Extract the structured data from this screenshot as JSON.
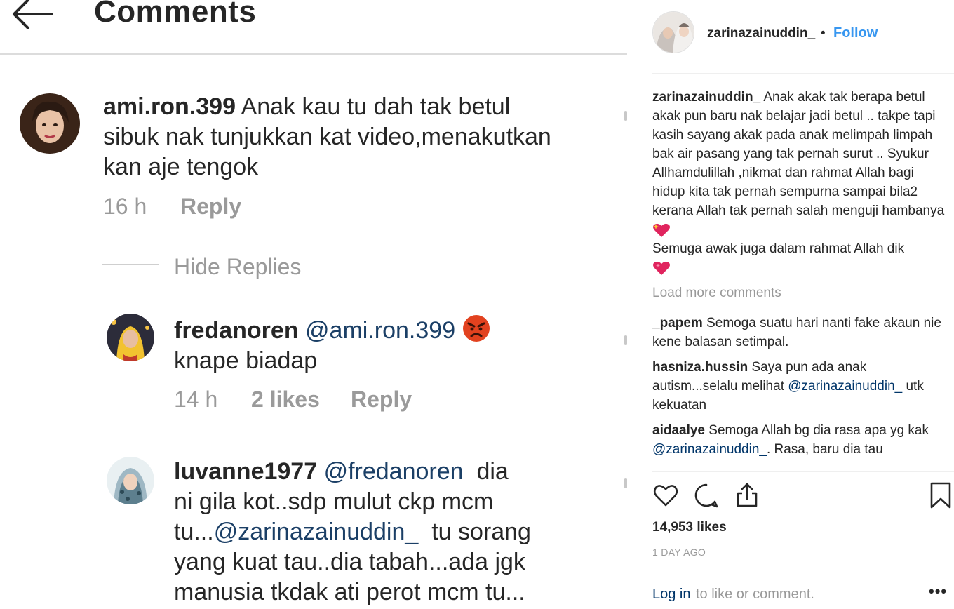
{
  "left": {
    "header": {
      "title": "Comments"
    },
    "comments": [
      {
        "username": "ami.ron.399",
        "line1": "Anak kau tu dah tak betul",
        "line2": "sibuk nak tunjukkan kat video,menakutkan",
        "line3": "kan aje tengok",
        "time": "16 h",
        "reply": "Reply"
      }
    ],
    "hide_replies": "Hide Replies",
    "replies": [
      {
        "username": "fredanoren",
        "mention": "@ami.ron.399",
        "line2": "knape biadap",
        "time": "14 h",
        "likes": "2 likes",
        "reply": "Reply"
      },
      {
        "username": "luvanne1977",
        "mention": "@fredanoren",
        "line1_rest": "dia",
        "line2": "ni gila kot..sdp mulut ckp mcm",
        "line3_pre": "tu...",
        "line3_mention": "@zarinazainuddin_",
        "line3_rest": "tu sorang",
        "line4": "yang kuat tau..dia tabah...ada jgk",
        "line5": "manusia tkdak ati perot mcm tu..."
      }
    ]
  },
  "right": {
    "header": {
      "username": "zarinazainuddin_",
      "dot": "•",
      "follow": "Follow"
    },
    "caption": {
      "username": "zarinazainuddin_",
      "text1": "Anak akak tak berapa betul akak pun baru nak belajar jadi betul .. takpe tapi kasih sayang akak pada anak melimpah limpah bak air pasang yang tak pernah surut .. Syukur Allhamdulillah ,nikmat dan rahmat Allah bagi hidup kita tak pernah sempurna sampai bila2 kerana Allah tak pernah salah menguji hambanya",
      "text2": "Semuga awak juga dalam rahmat Allah dik"
    },
    "load_more": "Load more comments",
    "comments": [
      {
        "username": "_papem",
        "text": "Semoga suatu hari nanti fake akaun nie kene balasan setimpal."
      },
      {
        "username": "hasniza.hussin",
        "text": "Saya pun ada anak autism...selalu melihat",
        "mention": "@zarinazainuddin_",
        "text_after": "utk kekuatan"
      },
      {
        "username": "aidaalye",
        "text": "Semoga Allah bg dia rasa apa yg kak",
        "mention": "@zarinazainuddin_",
        "text_after": ". Rasa, baru dia tau"
      }
    ],
    "actions": {
      "icons": [
        "heart-icon",
        "comment-icon",
        "share-icon",
        "bookmark-icon"
      ],
      "likes": "14,953 likes",
      "time": "1 DAY AGO"
    },
    "footer": {
      "login": "Log in",
      "login_rest": "to like or comment.",
      "more": "•••"
    }
  },
  "colors": {
    "follow": "#3897f0",
    "mention": "#003569",
    "muted": "#999999",
    "emoji_heart": "#e0245e",
    "angry_face": "#e2421f"
  }
}
